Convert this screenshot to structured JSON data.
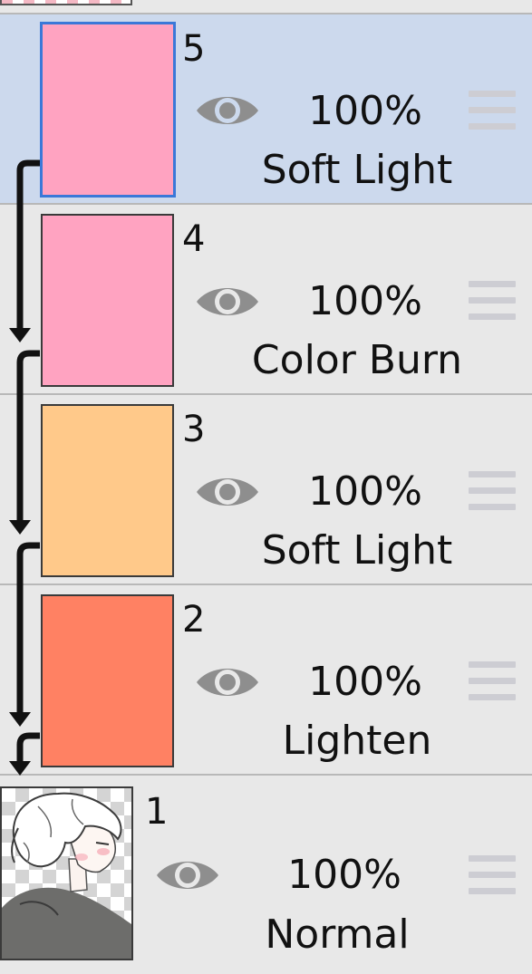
{
  "layers": [
    {
      "number": "5",
      "opacity": "100%",
      "blend": "Soft Light",
      "color": "#ffa3c1",
      "selected": true,
      "clipped": true
    },
    {
      "number": "4",
      "opacity": "100%",
      "blend": "Color Burn",
      "color": "#ffa3c1",
      "selected": false,
      "clipped": true
    },
    {
      "number": "3",
      "opacity": "100%",
      "blend": "Soft Light",
      "color": "#ffc98a",
      "selected": false,
      "clipped": true
    },
    {
      "number": "2",
      "opacity": "100%",
      "blend": "Lighten",
      "color": "#ff8163",
      "selected": false,
      "clipped": true
    },
    {
      "number": "1",
      "opacity": "100%",
      "blend": "Normal",
      "color": "transparent",
      "selected": false,
      "clipped": false
    }
  ],
  "icons": {
    "visibility": "eye-icon",
    "reorder": "drag-handle-icon",
    "clip": "clipping-arrow-icon"
  },
  "colors": {
    "selected_bg": "#ccd9ed",
    "selected_border": "#3a78d8",
    "panel_bg": "#e8e8e8",
    "eye": "#8e8e8e"
  }
}
